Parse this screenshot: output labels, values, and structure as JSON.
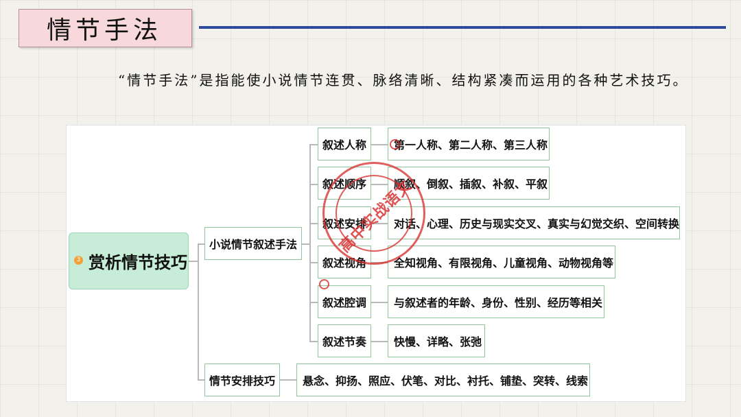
{
  "header": {
    "title": "情节手法"
  },
  "intro": "“情节手法”是指能使小说情节连贯、脉络清晰、结构紧凑而运用的各种艺术技巧。",
  "mindmap": {
    "root": {
      "badge": "3",
      "label": "赏析情节技巧"
    },
    "branches": [
      {
        "label": "小说情节叙述手法",
        "children": [
          {
            "label": "叙述人称",
            "detail": "第一人称、第二人称、第三人称"
          },
          {
            "label": "叙述顺序",
            "detail": "顺叙、倒叙、插叙、补叙、平叙"
          },
          {
            "label": "叙述安排",
            "detail": "对话、心理、历史与现实交叉、真实与幻觉交织、空间转换"
          },
          {
            "label": "叙述视角",
            "detail": "全知视角、有限视角、儿童视角、动物视角等"
          },
          {
            "label": "叙述腔调",
            "detail": "与叙述者的年龄、身份、性别、经历等相关"
          },
          {
            "label": "叙述节奏",
            "detail": "快慢、详略、张弛"
          }
        ]
      },
      {
        "label": "情节安排技巧",
        "detail": "悬念、抑扬、照应、伏笔、对比、衬托、铺垫、突转、线索"
      }
    ]
  },
  "watermark": {
    "text": "高中实战语文"
  }
}
